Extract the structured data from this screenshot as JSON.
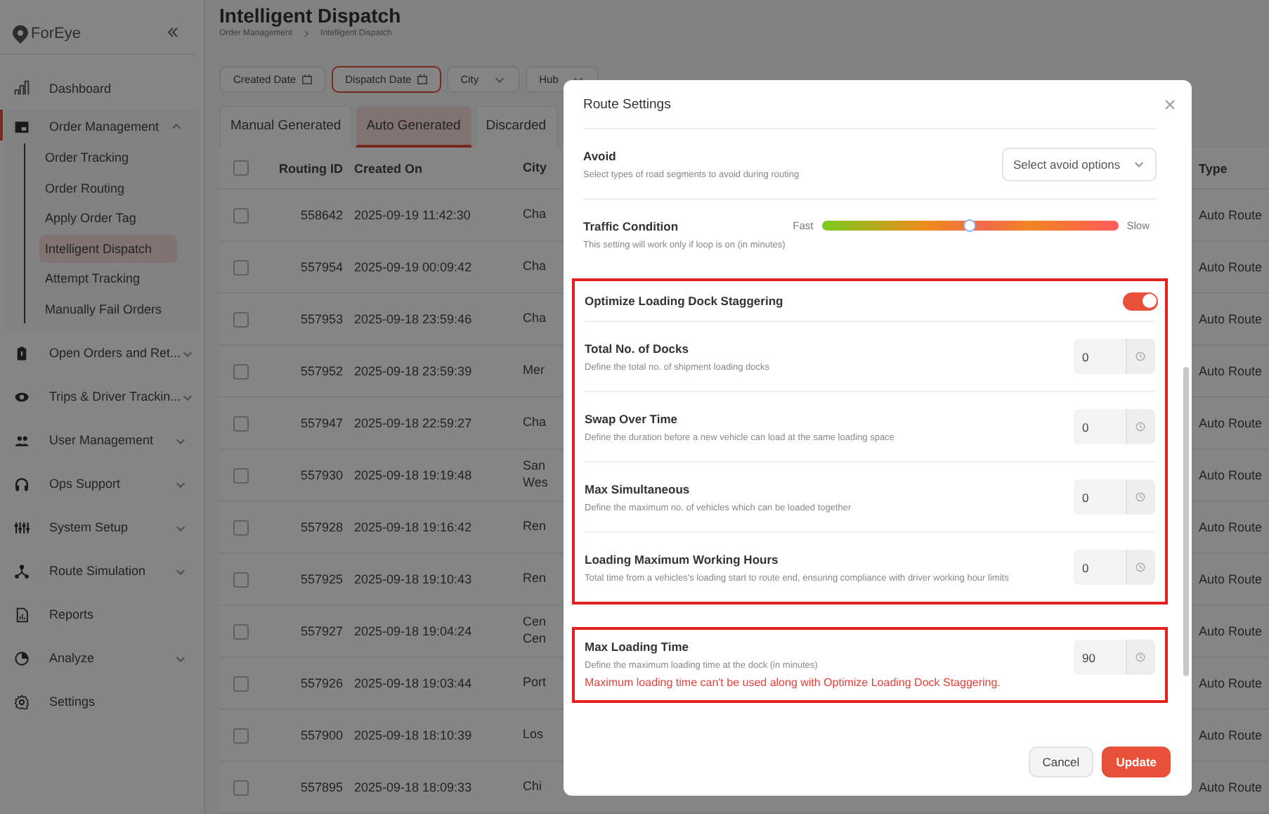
{
  "sidebar": {
    "logo": "ForEye",
    "items": [
      {
        "label": "Dashboard",
        "kind": "link",
        "selected": false
      },
      {
        "label": "Order Management",
        "kind": "group",
        "expanded": true,
        "selected": true,
        "children": [
          {
            "label": "Order Tracking",
            "selected": false
          },
          {
            "label": "Order Routing",
            "selected": false
          },
          {
            "label": "Apply Order Tag",
            "selected": false
          },
          {
            "label": "Intelligent Dispatch",
            "selected": true
          },
          {
            "label": "Attempt Tracking",
            "selected": false
          },
          {
            "label": "Manually Fail Orders",
            "selected": false
          }
        ]
      },
      {
        "label": "Open Orders and Ret...",
        "kind": "group",
        "expanded": false,
        "selected": false
      },
      {
        "label": "Trips & Driver Trackin...",
        "kind": "group",
        "expanded": false,
        "selected": false
      },
      {
        "label": "User Management",
        "kind": "group",
        "expanded": false,
        "selected": false
      },
      {
        "label": "Ops Support",
        "kind": "group",
        "expanded": false,
        "selected": false
      },
      {
        "label": "System Setup",
        "kind": "group",
        "expanded": false,
        "selected": false
      },
      {
        "label": "Route Simulation",
        "kind": "group",
        "expanded": false,
        "selected": false
      },
      {
        "label": "Reports",
        "kind": "link",
        "selected": false
      },
      {
        "label": "Analyze",
        "kind": "group",
        "expanded": false,
        "selected": false
      },
      {
        "label": "Settings",
        "kind": "link",
        "selected": false
      }
    ]
  },
  "header": {
    "title": "Intelligent Dispatch",
    "breadcrumbs": [
      "Order Management",
      "Intelligent Dispatch"
    ]
  },
  "filters": [
    {
      "label": "Created Date",
      "kind": "date",
      "selected": false
    },
    {
      "label": "Dispatch Date",
      "kind": "date",
      "selected": true
    },
    {
      "label": "City",
      "kind": "dropdown",
      "selected": false
    },
    {
      "label": "Hub",
      "kind": "dropdown",
      "selected": false
    }
  ],
  "tabs": [
    {
      "label": "Manual Generated",
      "selected": false
    },
    {
      "label": "Auto Generated",
      "selected": true
    },
    {
      "label": "Discarded",
      "selected": false
    }
  ],
  "table": {
    "columns": [
      "Routing ID",
      "Created On",
      "City",
      "Type"
    ],
    "all_checked": false,
    "rows": [
      {
        "checked": false,
        "cells": [
          "558642",
          "2025-09-19 11:42:30",
          "Cha",
          "Auto Route"
        ]
      },
      {
        "checked": false,
        "cells": [
          "557954",
          "2025-09-19 00:09:42",
          "Cha",
          "Auto Route"
        ]
      },
      {
        "checked": false,
        "cells": [
          "557953",
          "2025-09-18 23:59:46",
          "Cha",
          "Auto Route"
        ]
      },
      {
        "checked": false,
        "cells": [
          "557952",
          "2025-09-18 23:59:39",
          "Mer",
          "Auto Route"
        ]
      },
      {
        "checked": false,
        "cells": [
          "557947",
          "2025-09-18 22:59:27",
          "Cha",
          "Auto Route"
        ]
      },
      {
        "checked": false,
        "cells": [
          "557930",
          "2025-09-18 19:19:48",
          "San Wes",
          "Auto Route"
        ]
      },
      {
        "checked": false,
        "cells": [
          "557928",
          "2025-09-18 19:16:42",
          "Ren",
          "Auto Route"
        ]
      },
      {
        "checked": false,
        "cells": [
          "557925",
          "2025-09-18 19:10:43",
          "Ren",
          "Auto Route"
        ]
      },
      {
        "checked": false,
        "cells": [
          "557927",
          "2025-09-18 19:04:24",
          "Cen Cen",
          "Auto Route"
        ]
      },
      {
        "checked": false,
        "cells": [
          "557926",
          "2025-09-18 19:03:44",
          "Port",
          "Auto Route"
        ]
      },
      {
        "checked": false,
        "cells": [
          "557900",
          "2025-09-18 18:10:39",
          "Los",
          "Auto Route"
        ]
      },
      {
        "checked": false,
        "cells": [
          "557895",
          "2025-09-18 18:09:33",
          "Chi",
          "Auto Route"
        ]
      }
    ]
  },
  "modal": {
    "title": "Route Settings",
    "settings": [
      {
        "kind": "select",
        "label": "Avoid",
        "description": "Select types of road segments to avoid during routing",
        "placeholder": "Select avoid options"
      },
      {
        "kind": "slider",
        "label": "Traffic Condition",
        "description": "This setting will work only if loop is on (in minutes)",
        "min_label": "Fast",
        "max_label": "Slow",
        "level": 0.5
      }
    ],
    "highlight_groups": [
      {
        "settings": [
          {
            "kind": "toggle",
            "label": "Optimize Loading Dock Staggering",
            "on": true
          },
          {
            "kind": "number",
            "label": "Total No. of Docks",
            "description": "Define the total no. of shipment loading docks",
            "value": "0"
          },
          {
            "kind": "number",
            "label": "Swap Over Time",
            "description": "Define the duration before a new vehicle can load at the same loading space",
            "value": "0"
          },
          {
            "kind": "number",
            "label": "Max Simultaneous",
            "description": "Define the maximum no. of vehicles which can be loaded together",
            "value": "0"
          },
          {
            "kind": "number",
            "label": "Loading Maximum Working Hours",
            "description": "Total time from a vehicles's loading start to route end, ensuring compliance with driver working hour limits",
            "value": "0"
          }
        ]
      },
      {
        "settings": [
          {
            "kind": "number",
            "label": "Max Loading Time",
            "description": "Define the maximum loading time at the dock (in minutes)",
            "value": "90",
            "error": "Maximum loading time can't be used along with Optimize Loading Dock Staggering."
          }
        ]
      }
    ],
    "buttons": [
      {
        "label": "Cancel",
        "kind": "secondary"
      },
      {
        "label": "Update",
        "kind": "primary"
      }
    ]
  }
}
